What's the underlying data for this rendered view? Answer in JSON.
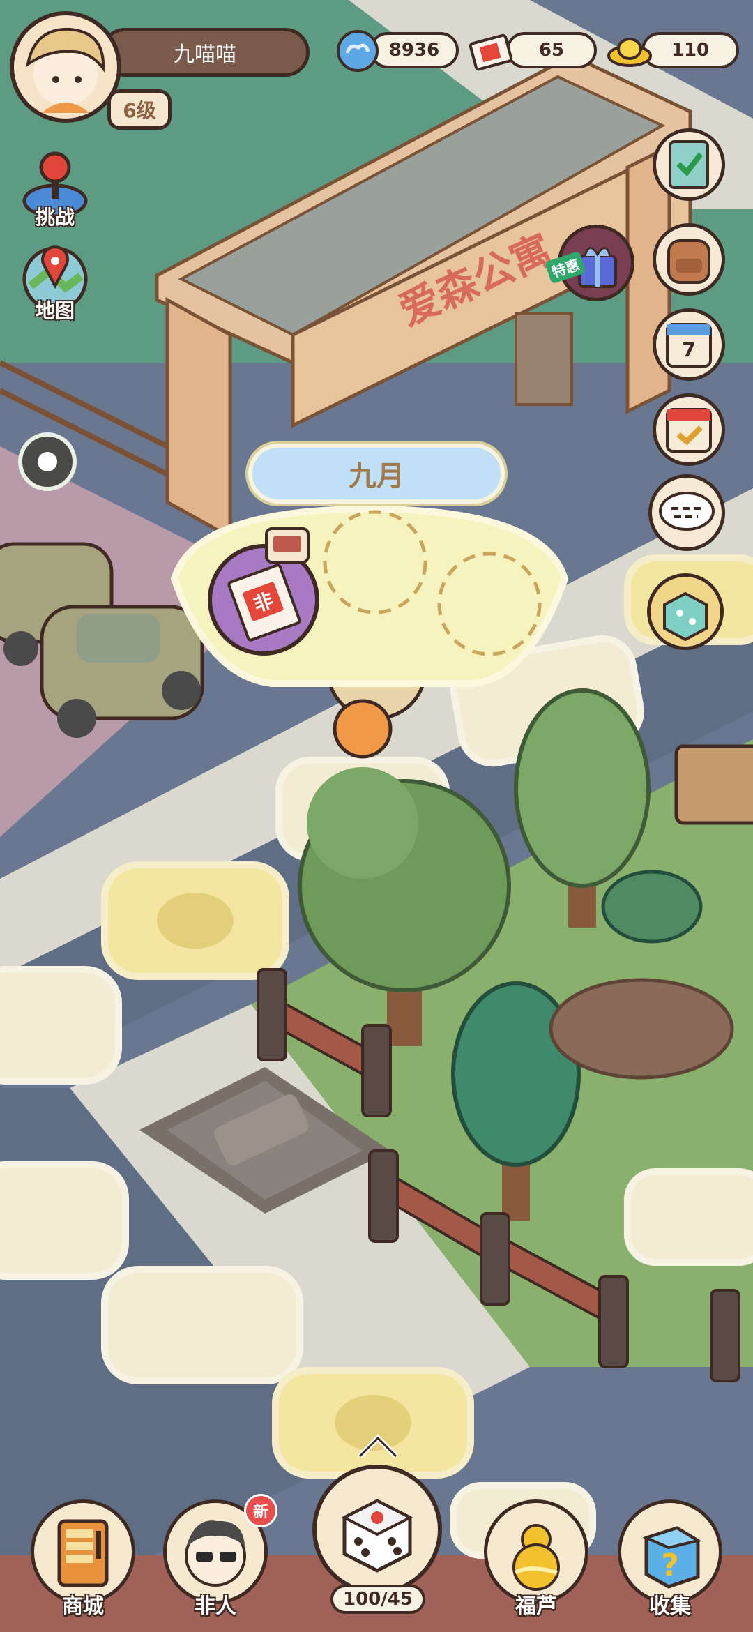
{
  "player": {
    "name": "九喵喵",
    "level": "6级"
  },
  "currencies": [
    {
      "icon": "cloud-coin-icon",
      "value": "8936"
    },
    {
      "icon": "fei-ticket-icon",
      "value": "65"
    },
    {
      "icon": "gold-ingot-icon",
      "value": "110"
    }
  ],
  "left_menu": {
    "challenge": "挑战",
    "map": "地图"
  },
  "scene": {
    "building_sign": "爱森公寓",
    "gift_tag": "特惠",
    "calendar_day": "7"
  },
  "popup": {
    "month": "九月",
    "ticket_char": "非"
  },
  "bottom_bar": {
    "shop": "商城",
    "feiren": "非人",
    "new_badge": "新",
    "dice_count": "100/45",
    "gourd": "福芦",
    "collect": "收集"
  },
  "colors": {
    "road": "#5f6d85",
    "sidewalk": "#d7d7cf",
    "grass": "#7fa46a",
    "tile_cream": "#f3ecd2",
    "tile_yellow": "#f4e5a1",
    "outline": "#3e2a22"
  }
}
